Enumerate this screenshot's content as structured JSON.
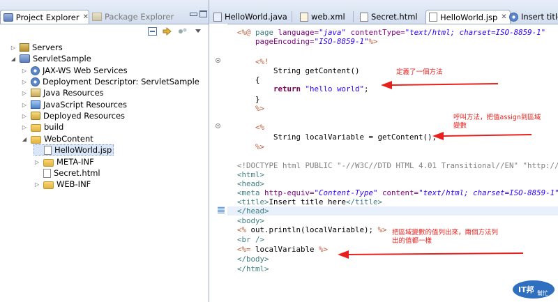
{
  "left_panel": {
    "tabs": [
      {
        "label": "Project Explorer",
        "close": "✕"
      },
      {
        "label": "Package Explorer"
      }
    ],
    "tree": [
      {
        "label": "Servers",
        "icon": "server-folder-icon",
        "expander": "▷",
        "indent": 0
      },
      {
        "label": "ServletSample",
        "icon": "web-project-icon",
        "expander": "◢",
        "indent": 0
      },
      {
        "label": "JAX-WS Web Services",
        "icon": "web-services-icon",
        "expander": "▷",
        "indent": 1
      },
      {
        "label": "Deployment Descriptor: ServletSample",
        "icon": "deployment-descriptor-icon",
        "expander": "▷",
        "indent": 1
      },
      {
        "label": "Java Resources",
        "icon": "java-resources-icon",
        "expander": "▷",
        "indent": 1
      },
      {
        "label": "JavaScript Resources",
        "icon": "javascript-resources-icon",
        "expander": "▷",
        "indent": 1
      },
      {
        "label": "Deployed Resources",
        "icon": "deployed-resources-icon",
        "expander": "▷",
        "indent": 1
      },
      {
        "label": "build",
        "icon": "folder-icon",
        "expander": "▷",
        "indent": 1
      },
      {
        "label": "WebContent",
        "icon": "folder-icon",
        "expander": "◢",
        "indent": 1
      },
      {
        "label": "HelloWorld.jsp",
        "icon": "jsp-file-icon",
        "expander": "",
        "indent": 2,
        "selected": true
      },
      {
        "label": "META-INF",
        "icon": "folder-icon",
        "expander": "▷",
        "indent": 2
      },
      {
        "label": "Secret.html",
        "icon": "html-file-icon",
        "expander": "",
        "indent": 2
      },
      {
        "label": "WEB-INF",
        "icon": "folder-icon",
        "expander": "▷",
        "indent": 2
      }
    ]
  },
  "editor": {
    "tabs": [
      {
        "label": "HelloWorld.java"
      },
      {
        "label": "web.xml"
      },
      {
        "label": "Secret.html"
      },
      {
        "label": "HelloWorld.jsp",
        "active": true,
        "close": "✕"
      },
      {
        "label": "Insert title h"
      }
    ],
    "code": {
      "l1a": "<%@ ",
      "l1b": "page ",
      "l1c": "language=",
      "l1d": "\"java\"",
      "l1e": " contentType=",
      "l1f": "\"text/html; charset=ISO-8859-1\"",
      "l2a": "pageEncoding=",
      "l2b": "\"ISO-8859-1\"",
      "l2c": "%>",
      "l3": "<%!",
      "l4": "String getContent()",
      "l5": "{",
      "l6a": "return",
      "l6b": " \"hello world\"",
      "l6c": ";",
      "l7": "}",
      "l8": "%>",
      "l9": "<%",
      "l10": "String localVariable = getContent();",
      "l11": "%>",
      "l12a": "<!DOCTYPE html PUBLIC \"-//W3C//DTD HTML 4.01 Transitional//EN\" \"http://w",
      "l13": "<html>",
      "l14": "<head>",
      "l15a": "<meta ",
      "l15b": "http-equiv=",
      "l15c": "\"Content-Type\"",
      "l15d": " content=",
      "l15e": "\"text/html; charset=ISO-8859-1\"",
      "l15f": ">",
      "l16a": "<title>",
      "l16b": "Insert title here",
      "l16c": "</title>",
      "l17": "</head>",
      "l18": "<body>",
      "l19a": "<%",
      "l19b": " out.println(localVariable); ",
      "l19c": "%>",
      "l20": "<br />",
      "l21a": "<%=",
      "l21b": " localVariable ",
      "l21c": "%>",
      "l22": "</body>",
      "l23": "</html>"
    },
    "annotations": {
      "a1": "定義了一個方法",
      "a2": "呼叫方法，把值assign到區域\n變數",
      "a3": "把區域變數的值列出來，兩個方法列\n出的值都一樣"
    },
    "annotation_color": "#e8201d"
  },
  "logo": {
    "text": "IT邦",
    "sub": "幫忙"
  }
}
